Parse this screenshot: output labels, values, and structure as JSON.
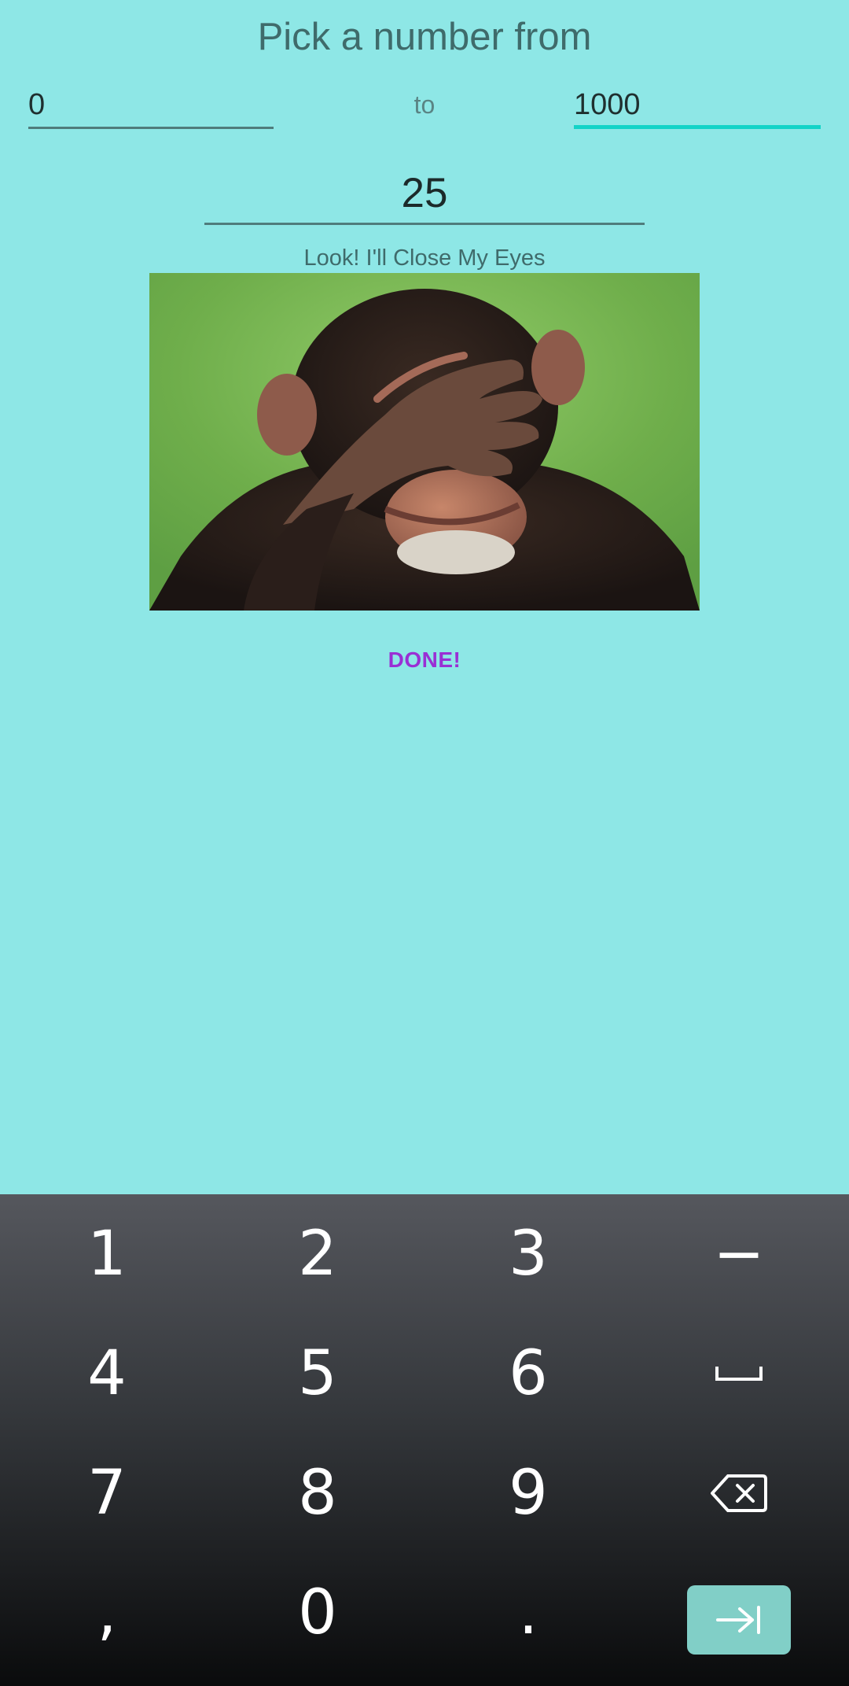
{
  "app": {
    "title": "Pick a number from",
    "range": {
      "from_value": "0",
      "to_label": "to",
      "to_value": "1000"
    },
    "guess": {
      "value": "25"
    },
    "image_caption": "Look! I'll Close My Eyes",
    "image_subject": "chimpanzee covering its eyes with hand",
    "done_label": "DONE!"
  },
  "keyboard": {
    "rows": [
      [
        "1",
        "2",
        "3",
        "−"
      ],
      [
        "4",
        "5",
        "6",
        "space-icon"
      ],
      [
        "7",
        "8",
        "9",
        "backspace-icon"
      ],
      [
        ",",
        "0",
        ".",
        "next-icon"
      ]
    ],
    "accent_color": "#81cfc7"
  },
  "colors": {
    "background": "#8ee7e6",
    "focus_underline": "#13d3c7",
    "done_button": "#9a2fd4"
  }
}
